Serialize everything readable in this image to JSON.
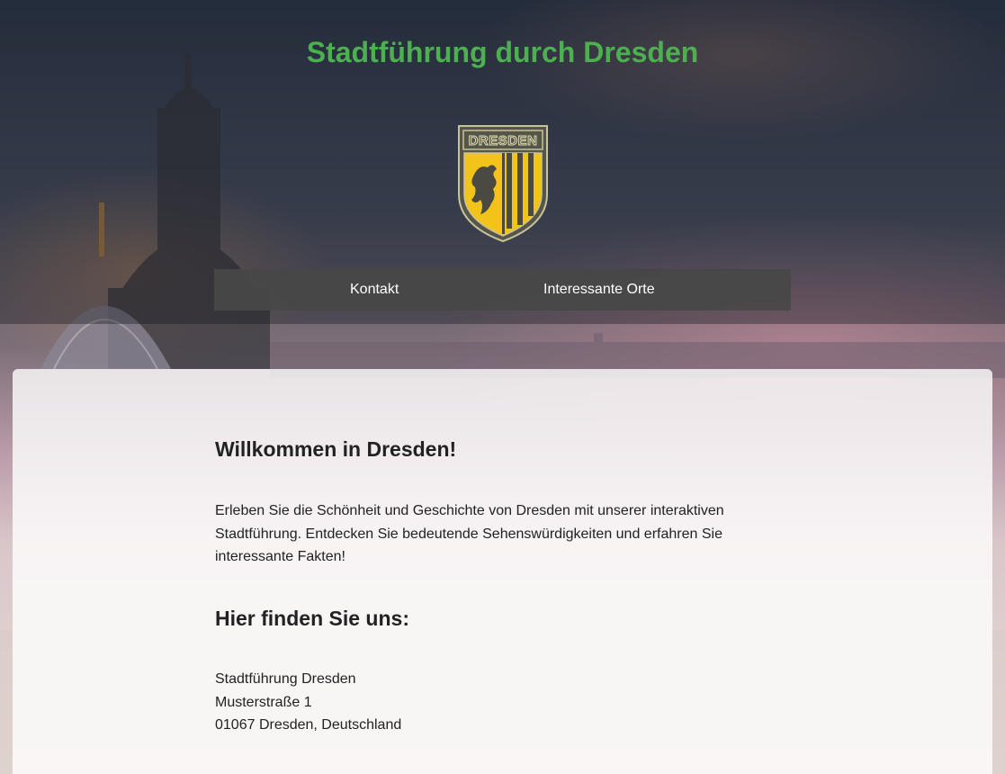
{
  "header": {
    "title": "Stadtführung durch Dresden",
    "logo_text": "DRESDEN",
    "logo_icon": "dresden-coat-of-arms-icon"
  },
  "nav": {
    "items": [
      {
        "label": "Kontakt"
      },
      {
        "label": "Interessante Orte"
      }
    ]
  },
  "main": {
    "welcome_heading": "Willkommen in Dresden!",
    "intro_text": "Erleben Sie die Schönheit und Geschichte von Dresden mit unserer interaktiven Stadtführung. Entdecken Sie bedeutende Sehenswürdigkeiten und erfahren Sie interessante Fakten!",
    "find_heading": "Hier finden Sie uns:",
    "address": {
      "line1": "Stadtführung Dresden",
      "line2": "Musterstraße 1",
      "line3": "01067 Dresden, Deutschland"
    }
  },
  "colors": {
    "title": "#4caf50",
    "nav_bg": "#484848",
    "logo_gold": "#f2c318",
    "logo_dark": "#4a4a40"
  }
}
